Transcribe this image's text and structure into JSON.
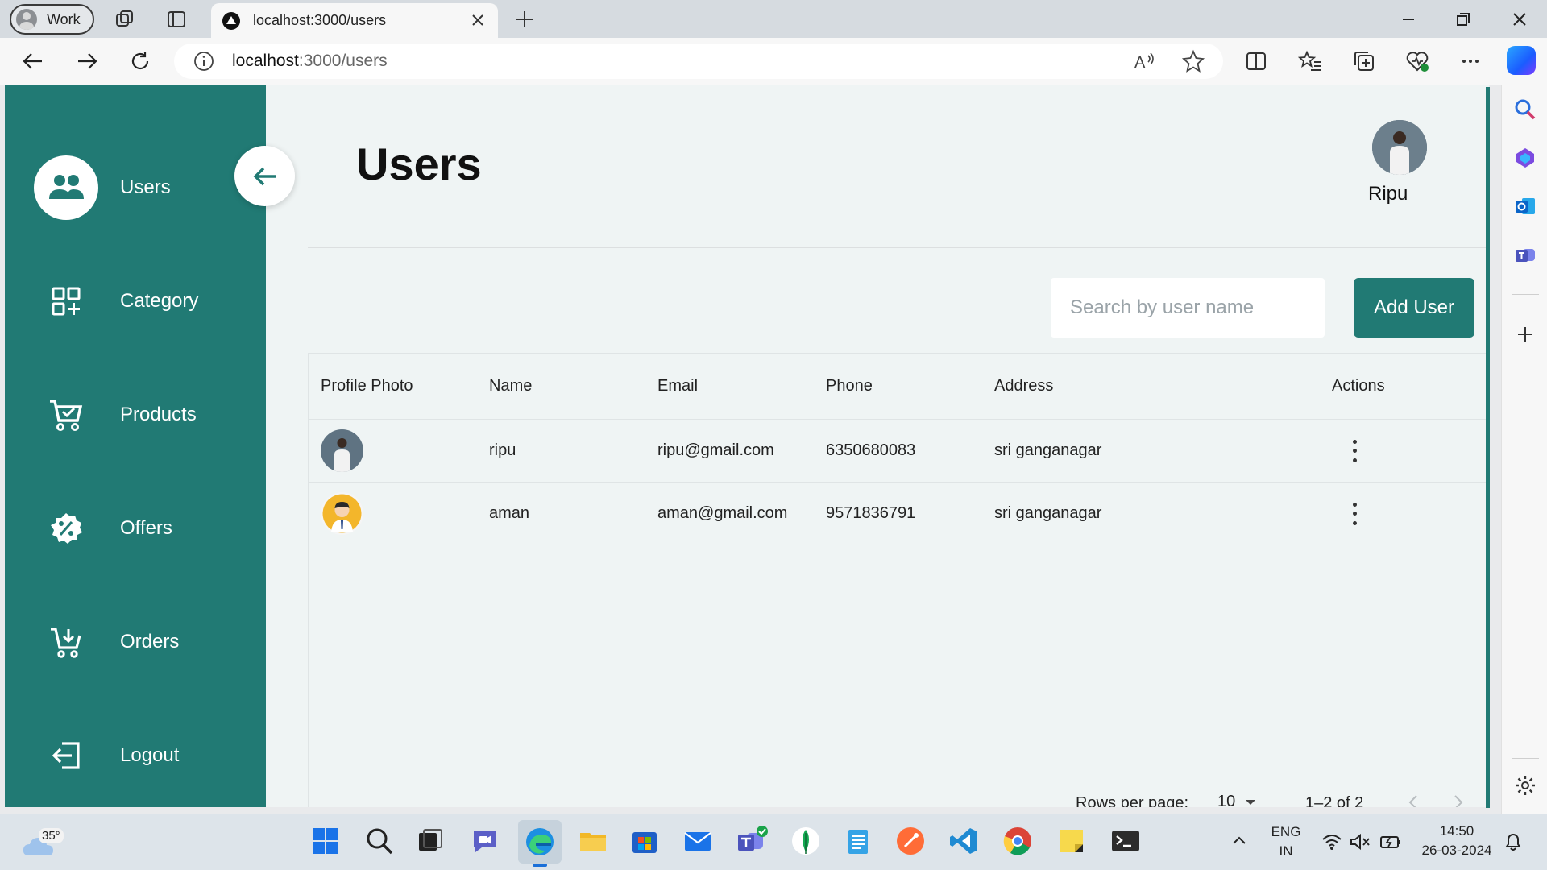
{
  "browser": {
    "profile_label": "Work",
    "tab_title": "localhost:3000/users",
    "url_host": "localhost",
    "url_path": ":3000/users"
  },
  "sidebar": {
    "items": [
      {
        "label": "Users",
        "icon": "users-icon"
      },
      {
        "label": "Category",
        "icon": "category-grid-icon"
      },
      {
        "label": "Products",
        "icon": "cart-icon"
      },
      {
        "label": "Offers",
        "icon": "discount-badge-icon"
      },
      {
        "label": "Orders",
        "icon": "cart-add-icon"
      },
      {
        "label": "Logout",
        "icon": "logout-icon"
      }
    ],
    "active_color": "#217a74"
  },
  "header": {
    "title": "Users",
    "user_name": "Ripu"
  },
  "toolbar": {
    "search_placeholder": "Search by user name",
    "add_label": "Add User"
  },
  "table": {
    "columns": [
      "Profile Photo",
      "Name",
      "Email",
      "Phone",
      "Address",
      "Actions"
    ],
    "rows": [
      {
        "name": "ripu",
        "email": "ripu@gmail.com",
        "phone": "6350680083",
        "address": "sri ganganagar"
      },
      {
        "name": "aman",
        "email": "aman@gmail.com",
        "phone": "9571836791",
        "address": "sri ganganagar"
      }
    ]
  },
  "pagination": {
    "rows_per_page_label": "Rows per page:",
    "rows_per_page_value": "10",
    "range_label": "1–2 of 2"
  },
  "taskbar": {
    "temperature": "35°",
    "language": "ENG",
    "region": "IN",
    "time": "14:50",
    "date": "26-03-2024"
  },
  "colors": {
    "brand": "#217a74",
    "page_bg": "#eff4f4"
  }
}
